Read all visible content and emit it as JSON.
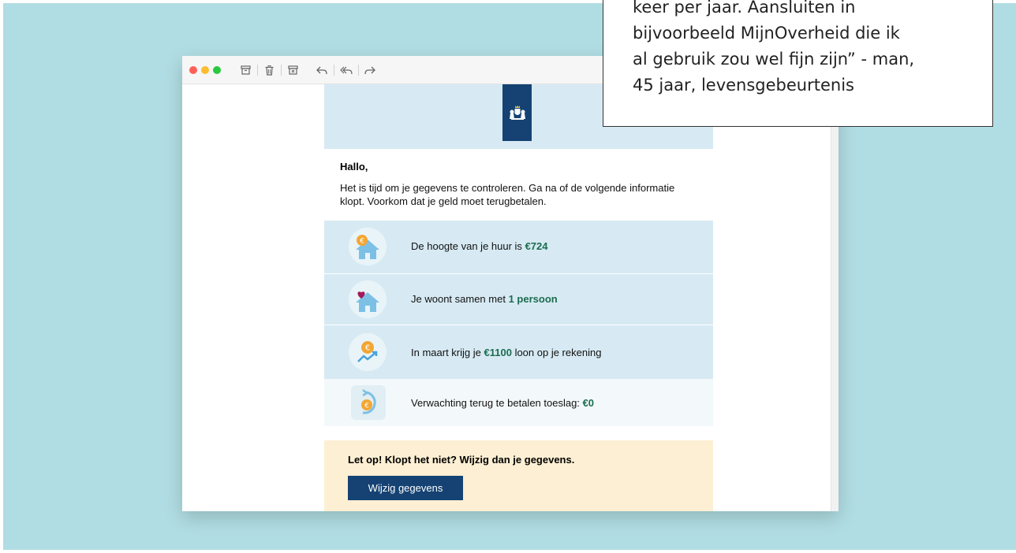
{
  "email": {
    "greeting": "Hallo,",
    "intro": "Het is tijd om je gegevens te controleren. Ga na of de volgende informatie klopt. Voorkom dat je geld moet terugbetalen.",
    "rows": [
      {
        "icon": "house-euro-icon",
        "text": "De hoogte van je huur is",
        "value": "€724"
      },
      {
        "icon": "house-heart-icon",
        "text": "Je woont samen met",
        "value": "1 persoon"
      },
      {
        "icon": "coin-growth-icon",
        "text": "In maart krijg je",
        "value": "€1100",
        "suffix": "loon op je rekening"
      },
      {
        "icon": "coin-return-icon",
        "text": "Verwachting terug te betalen toeslag:",
        "value": "€0"
      }
    ],
    "notice": {
      "title": "Let op! Klopt het niet? Wijzig dan je gegevens.",
      "button_label": "Wijzig gegevens"
    }
  },
  "quote": {
    "text": "keer per jaar. Aansluiten in\nbijvoorbeeld MijnOverheid die ik\nal gebruik zou wel fijn zijn” - man,\n45 jaar, levensgebeurtenis"
  },
  "colors": {
    "backdrop": "#b0dde3",
    "rijksoverheid_blue": "#154273",
    "row_blue": "#d7eaf4",
    "value_green": "#1b6c4e",
    "notice_yellow": "#fcefd3"
  }
}
